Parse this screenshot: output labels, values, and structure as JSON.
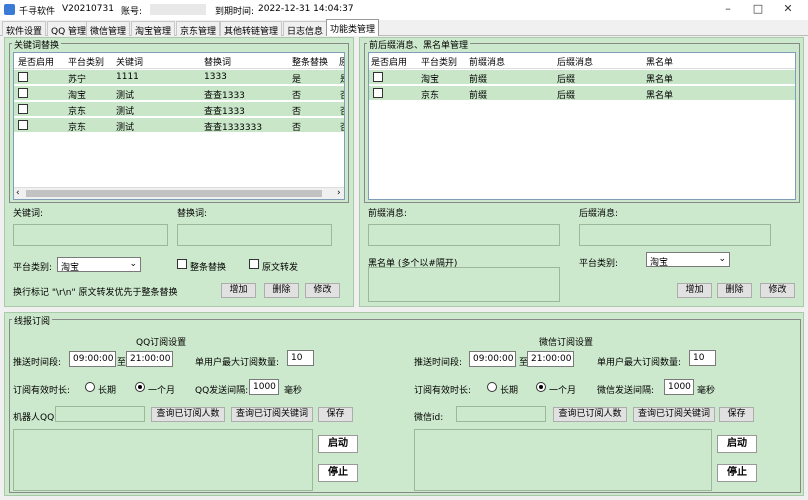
{
  "window": {
    "app_name": "千寻软件",
    "version": "V20210731",
    "account_label": "账号:",
    "expire_label": "到期时间:",
    "expire_value": "2022-12-31 14:04:37"
  },
  "tabs": [
    "软件设置",
    "QQ 管理",
    "微信管理",
    "淘宝管理",
    "京东管理",
    "其他转链管理",
    "日志信息",
    "功能类管理"
  ],
  "keyword_replace": {
    "title": "关键词替换",
    "columns": [
      "是否启用",
      "平台类别",
      "关键词",
      "替换词",
      "整条替换",
      "原"
    ],
    "rows": [
      [
        "苏宁",
        "1111",
        "1333",
        "是",
        "是"
      ],
      [
        "淘宝",
        "测试",
        "查查1333",
        "否",
        "否"
      ],
      [
        "京东",
        "测试",
        "查查1333",
        "否",
        "否"
      ],
      [
        "京东",
        "测试",
        "查查1333333",
        "否",
        "否"
      ]
    ],
    "keyword_label": "关键词:",
    "replace_label": "替换词:",
    "platform_label": "平台类别:",
    "platform_value": "淘宝",
    "whole_replace": "整条替换",
    "original_forward": "原文转发",
    "note": "换行标记 \"\\r\\n\" 原文转发优先于整条替换",
    "add": "增加",
    "delete": "删除",
    "modify": "修改"
  },
  "prefix_blacklist": {
    "title": "前后缀消息、黑名单管理",
    "columns": [
      "是否启用",
      "平台类别",
      "前缀消息",
      "后缀消息",
      "黑名单"
    ],
    "rows": [
      [
        "淘宝",
        "前缀",
        "后缀",
        "黑名单"
      ],
      [
        "京东",
        "前缀",
        "后缀",
        "黑名单"
      ]
    ],
    "prefix_label": "前缀消息:",
    "suffix_label": "后缀消息:",
    "blacklist_label": "黑名单 (多个以#隔开)",
    "platform_label": "平台类别:",
    "platform_value": "淘宝",
    "add": "增加",
    "delete": "删除",
    "modify": "修改"
  },
  "subscribe": {
    "title": "线报订阅",
    "qq": {
      "title": "QQ订阅设置",
      "push_label": "推送时间段:",
      "start": "09:00:00",
      "to": "至",
      "end": "21:00:00",
      "max_label": "单用户最大订阅数量:",
      "max_value": "10",
      "valid_label": "订阅有效时长:",
      "opt_long": "长期",
      "opt_month": "一个月",
      "interval_label": "QQ发送间隔:",
      "interval_value": "1000",
      "ms": "毫秒",
      "robot_label": "机器人QQ:",
      "query_users": "查询已订阅人数",
      "query_keywords": "查询已订阅关键词",
      "save": "保存",
      "start_btn": "启动",
      "stop_btn": "停止"
    },
    "wx": {
      "title": "微信订阅设置",
      "push_label": "推送时间段:",
      "start": "09:00:00",
      "to": "至",
      "end": "21:00:00",
      "max_label": "单用户最大订阅数量:",
      "max_value": "10",
      "valid_label": "订阅有效时长:",
      "opt_long": "长期",
      "opt_month": "一个月",
      "interval_label": "微信发送间隔:",
      "interval_value": "1000",
      "ms": "毫秒",
      "robot_label": "微信id:",
      "query_users": "查询已订阅人数",
      "query_keywords": "查询已订阅关键词",
      "save": "保存",
      "start_btn": "启动",
      "stop_btn": "停止"
    }
  }
}
